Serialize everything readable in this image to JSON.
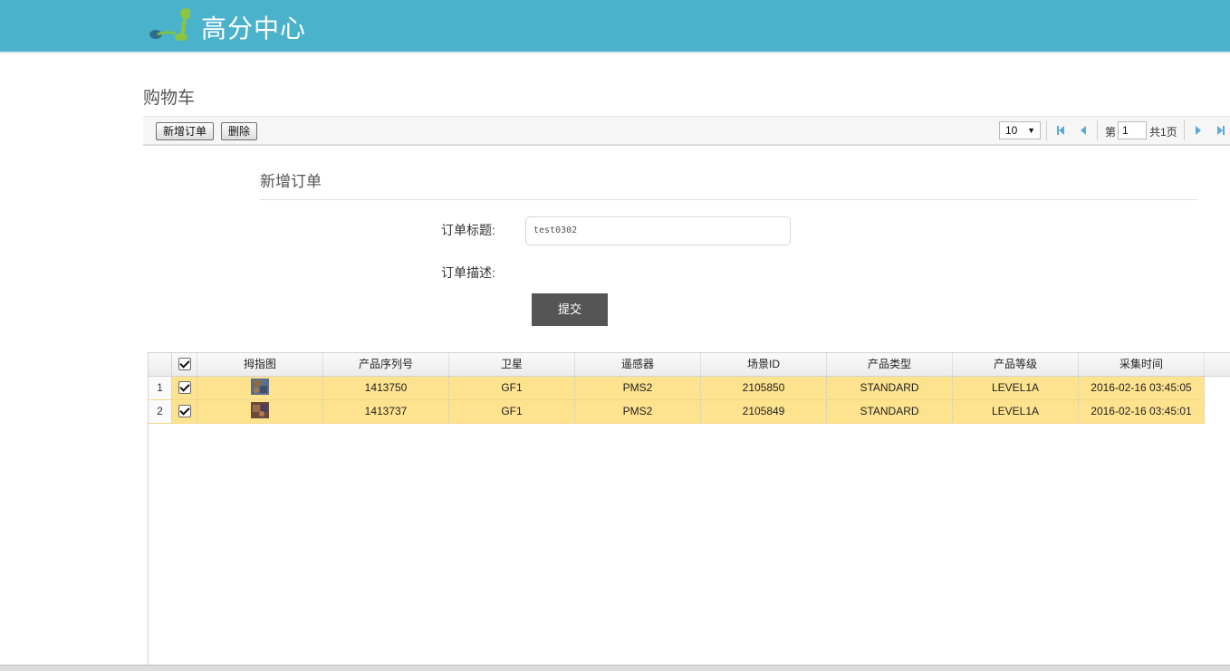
{
  "header": {
    "brand": "高分中心"
  },
  "page_title": "购物车",
  "toolbar": {
    "add_order_label": "新增订单",
    "delete_label": "删除",
    "page_size": "10",
    "page_prefix": "第",
    "current_page": "1",
    "page_total": "共1页"
  },
  "form": {
    "section_title": "新增订单",
    "title_label": "订单标题:",
    "title_value": "test0302",
    "desc_label": "订单描述:",
    "submit_label": "提交"
  },
  "table": {
    "columns": [
      "拇指图",
      "产品序列号",
      "卫星",
      "遥感器",
      "场景ID",
      "产品类型",
      "产品等级",
      "采集时间"
    ],
    "rows": [
      {
        "num": "1",
        "serial": "1413750",
        "satellite": "GF1",
        "sensor": "PMS2",
        "scene_id": "2105850",
        "type": "STANDARD",
        "level": "LEVEL1A",
        "time": "2016-02-16 03:45:05"
      },
      {
        "num": "2",
        "serial": "1413737",
        "satellite": "GF1",
        "sensor": "PMS2",
        "scene_id": "2105849",
        "type": "STANDARD",
        "level": "LEVEL1A",
        "time": "2016-02-16 03:45:01"
      }
    ]
  },
  "colors": {
    "header_bg": "#4bb2cc",
    "row_selected": "#fee38f",
    "submit_bg": "#555555",
    "pager_icon": "#5aa9d6"
  }
}
